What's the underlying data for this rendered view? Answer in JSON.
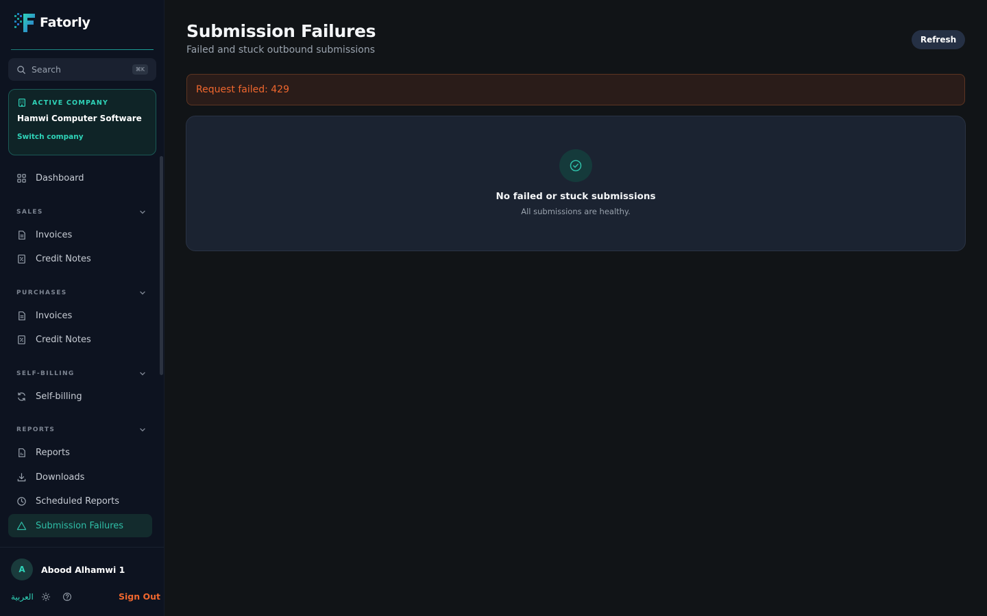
{
  "brand": {
    "name": "Fatorly",
    "accent": "#2fd3b8"
  },
  "search": {
    "label": "Search",
    "shortcut": "⌘K"
  },
  "company": {
    "tag": "ACTIVE COMPANY",
    "name": "Hamwi Computer Software",
    "switch_label": "Switch company"
  },
  "nav": {
    "dashboard": "Dashboard",
    "sections": [
      {
        "title": "SALES",
        "items": [
          "Invoices",
          "Credit Notes"
        ]
      },
      {
        "title": "PURCHASES",
        "items": [
          "Invoices",
          "Credit Notes"
        ]
      },
      {
        "title": "SELF-BILLING",
        "items": [
          "Self-billing"
        ]
      },
      {
        "title": "REPORTS",
        "items": [
          "Reports",
          "Downloads",
          "Scheduled Reports",
          "Submission Failures"
        ]
      }
    ],
    "active_item": "Submission Failures"
  },
  "user": {
    "initial": "A",
    "name": "Abood Alhamwi 1",
    "language": "العربية",
    "sign_out": "Sign Out"
  },
  "header": {
    "title": "Submission Failures",
    "subtitle": "Failed and stuck outbound submissions",
    "refresh_label": "Refresh"
  },
  "error": {
    "message": "Request failed: 429",
    "color": "#f0672e"
  },
  "empty_state": {
    "title": "No failed or stuck submissions",
    "subtitle": "All submissions are healthy."
  }
}
